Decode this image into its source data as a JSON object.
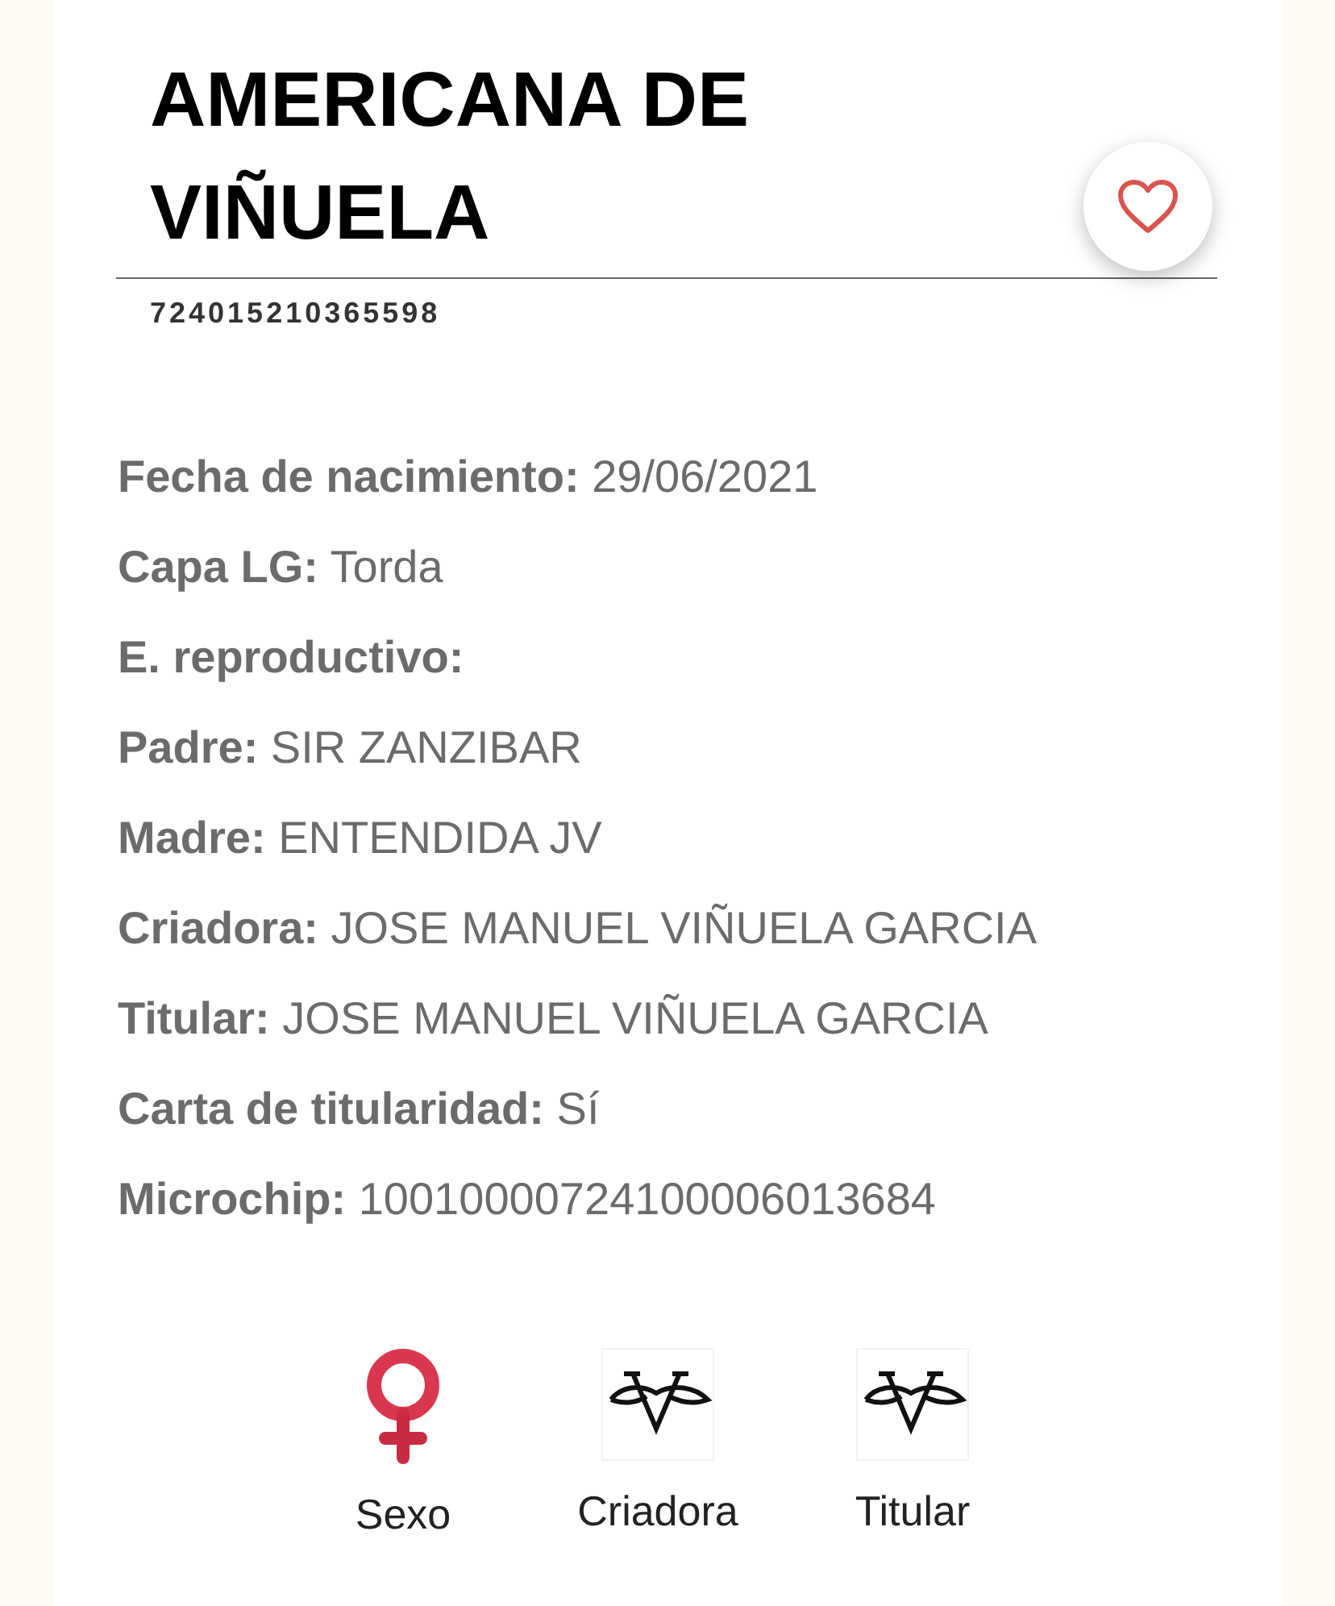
{
  "title": "AMERICANA DE VIÑUELA",
  "favorite": false,
  "code": "724015210365598",
  "fields": [
    {
      "label": "Fecha de nacimiento:",
      "value": "29/06/2021"
    },
    {
      "label": "Capa LG:",
      "value": "Torda"
    },
    {
      "label": "E. reproductivo:"
    },
    {
      "label": "Padre:",
      "value": "SIR ZANZIBAR"
    },
    {
      "label": "Madre:",
      "value": "ENTENDIDA JV"
    },
    {
      "label": "Criadora:",
      "value": "JOSE MANUEL VIÑUELA GARCIA"
    },
    {
      "label": "Titular:",
      "value": "JOSE MANUEL VIÑUELA GARCIA"
    },
    {
      "label": "Carta de titularidad:",
      "value": "Sí"
    },
    {
      "label": "Microchip:",
      "value": "10010000724100006013684"
    }
  ],
  "badges": [
    {
      "kind": "female",
      "label": "Sexo"
    },
    {
      "kind": "logo",
      "label": "Criadora"
    },
    {
      "kind": "logo",
      "label": "Titular"
    }
  ]
}
